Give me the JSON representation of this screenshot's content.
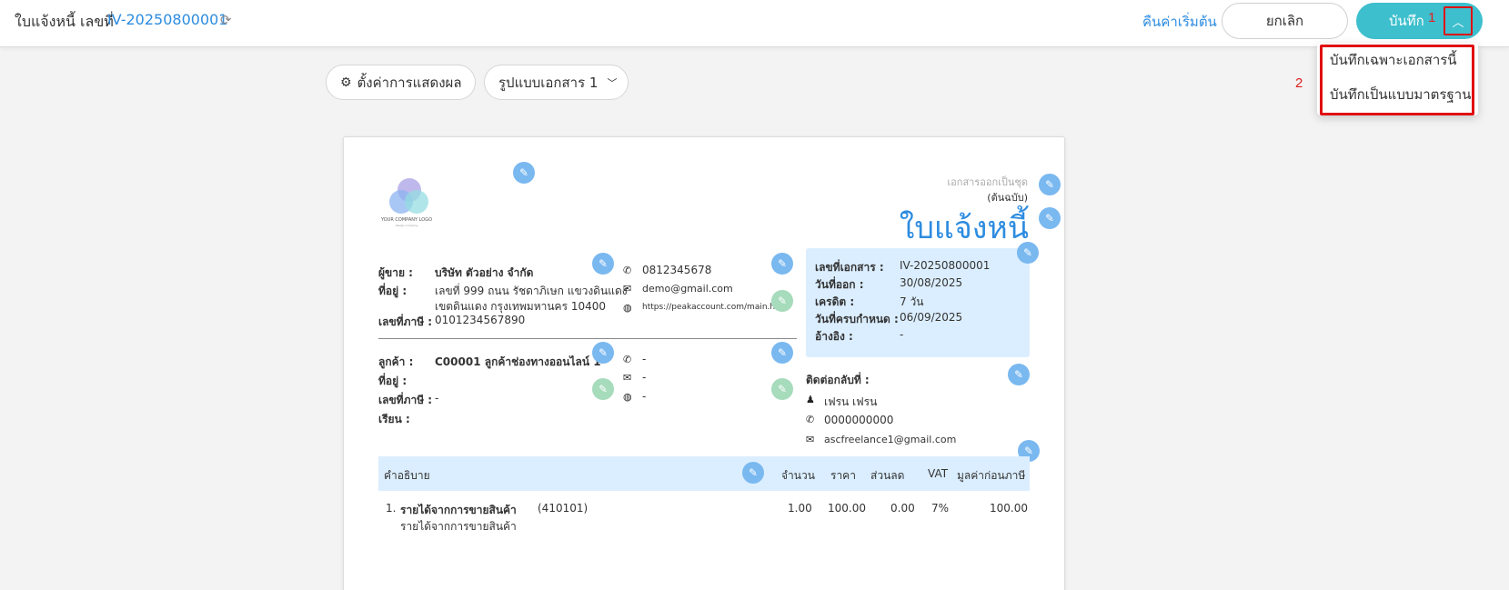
{
  "topbar": {
    "title": "ใบแจ้งหนี้ เลขที่",
    "doc_number": "IV-20250800001",
    "reset_label": "คืนค่าเริ่มต้น",
    "cancel_label": "ยกเลิก",
    "save_label": "บันทึก",
    "annotation_1": "1"
  },
  "dropdown": {
    "items": [
      "บันทึกเฉพาะเอกสารนี้",
      "บันทึกเป็นแบบมาตรฐาน"
    ],
    "annotation_2": "2"
  },
  "toolbar": {
    "settings_label": "ตั้งค่าการแสดงผล",
    "format_label": "รูปแบบเอกสาร 1"
  },
  "document": {
    "logo_text": "YOUR COMPANY LOGO",
    "logo_sub": "design company",
    "set_note": "เอกสารออกเป็นชุด",
    "copy_note": "(ต้นฉบับ)",
    "title": "ใบแจ้งหนี้",
    "seller": {
      "label_seller": "ผู้ขาย :",
      "name": "บริษัท ตัวอย่าง จำกัด",
      "label_address": "ที่อยู่ :",
      "address_1": "เลขที่ 999 ถนน รัชดาภิเษก แขวงดินแดง",
      "address_2": "เขตดินแดง กรุงเทพมหานคร 10400",
      "label_tax": "เลขที่ภาษี :",
      "tax_id": "0101234567890",
      "phone": "0812345678",
      "email": "demo@gmail.com",
      "website": "https://peakaccount.com/main.html"
    },
    "customer": {
      "label_customer": "ลูกค้า :",
      "name": "C00001 ลูกค้าช่องทางออนไลน์ 1",
      "label_address": "ที่อยู่ :",
      "label_tax": "เลขที่ภาษี :",
      "tax_id": "-",
      "label_attn": "เรียน :",
      "phone": "-",
      "email": "-",
      "website": "-"
    },
    "info": {
      "label_doc_no": "เลขที่เอกสาร :",
      "doc_no": "IV-20250800001",
      "label_issue": "วันที่ออก :",
      "issue_date": "30/08/2025",
      "label_credit": "เครดิต :",
      "credit": "7 วัน",
      "label_due": "วันที่ครบกำหนด :",
      "due_date": "06/09/2025",
      "label_ref": "อ้างอิง :",
      "ref": "-"
    },
    "contact": {
      "label": "ติดต่อกลับที่ :",
      "name": "เฟรน เฟรน",
      "phone": "0000000000",
      "email": "ascfreelance1@gmail.com"
    },
    "table": {
      "headers": [
        "คำอธิบาย",
        "จำนวน",
        "ราคา",
        "ส่วนลด",
        "VAT",
        "มูลค่าก่อนภาษี"
      ],
      "rows": [
        {
          "no": "1.",
          "name": "รายได้จากการขายสินค้า",
          "code": "(410101)",
          "desc": "รายได้จากการขายสินค้า",
          "qty": "1.00",
          "price": "100.00",
          "discount": "0.00",
          "vat": "7%",
          "amount": "100.00"
        }
      ]
    }
  },
  "colors": {
    "accent": "#2d8ce0",
    "save_button": "#3dbfcd",
    "highlight": "#e01010",
    "info_bg": "#dbeeff"
  },
  "icons": [
    "refresh-icon",
    "gear-icon",
    "chevron-down-icon",
    "chevron-up-icon",
    "pencil-icon",
    "phone-icon",
    "mail-icon",
    "globe-icon",
    "user-icon"
  ]
}
